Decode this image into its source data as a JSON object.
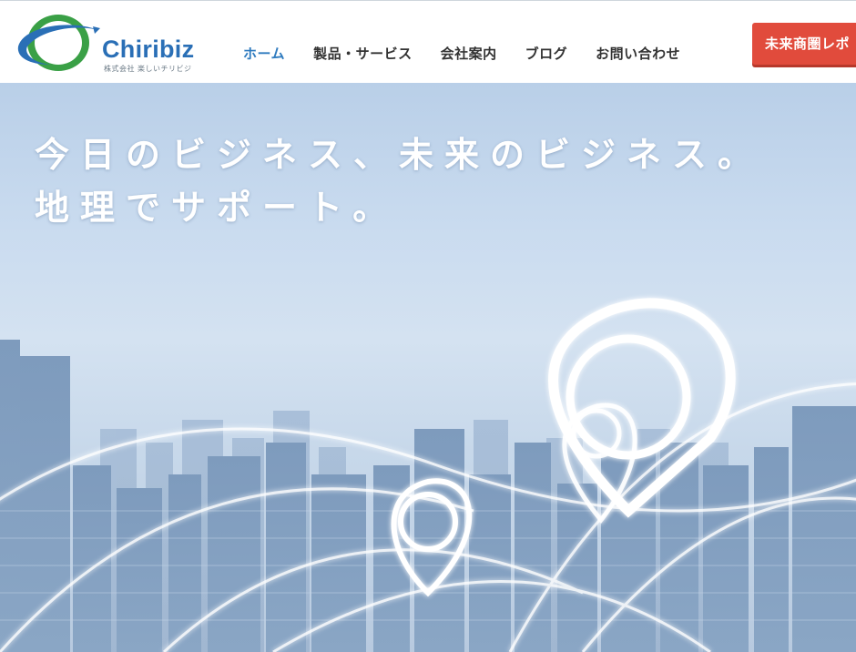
{
  "brand": {
    "name": "Chiribiz",
    "tagline": "株式会社 楽しいチリビジ"
  },
  "nav": {
    "items": [
      {
        "label": "ホーム",
        "active": true
      },
      {
        "label": "製品・サービス",
        "active": false
      },
      {
        "label": "会社案内",
        "active": false
      },
      {
        "label": "ブログ",
        "active": false
      },
      {
        "label": "お問い合わせ",
        "active": false
      }
    ]
  },
  "cta": {
    "label": "未来商圏レポ"
  },
  "hero": {
    "line1": "今日のビジネス、未来のビジネス。",
    "line2": "地理でサポート。"
  },
  "colors": {
    "brand_blue": "#2a6fb6",
    "brand_green": "#3aa046",
    "nav_active": "#2f7bbf",
    "cta_red": "#e14b3c"
  }
}
